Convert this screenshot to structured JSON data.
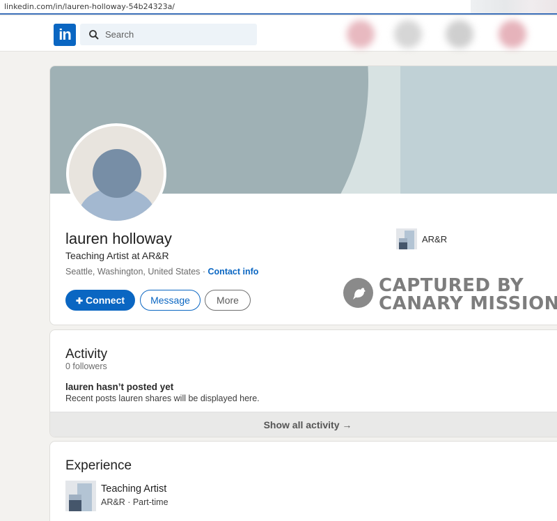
{
  "browser": {
    "url": "linkedin.com/in/lauren-holloway-54b24323a/"
  },
  "nav": {
    "logo_text": "in",
    "search_placeholder": "Search"
  },
  "profile": {
    "name": "lauren holloway",
    "headline": "Teaching Artist at AR&R",
    "location": "Seattle, Washington, United States",
    "separator": " · ",
    "contact_label": "Contact info",
    "company": "AR&R",
    "buttons": {
      "connect": "Connect",
      "message": "Message",
      "more": "More"
    }
  },
  "watermark": {
    "line1": "CAPTURED BY",
    "line2": "CANARY MISSION"
  },
  "activity": {
    "title": "Activity",
    "followers": "0 followers",
    "empty_title": "lauren hasn’t posted yet",
    "empty_desc": "Recent posts lauren shares will be displayed here.",
    "show_all": "Show all activity →"
  },
  "experience": {
    "title": "Experience",
    "items": [
      {
        "role": "Teaching Artist",
        "company": "AR&R · Part-time"
      }
    ]
  },
  "colors": {
    "brand": "#0a66c2",
    "page_bg": "#f3f2ef"
  }
}
